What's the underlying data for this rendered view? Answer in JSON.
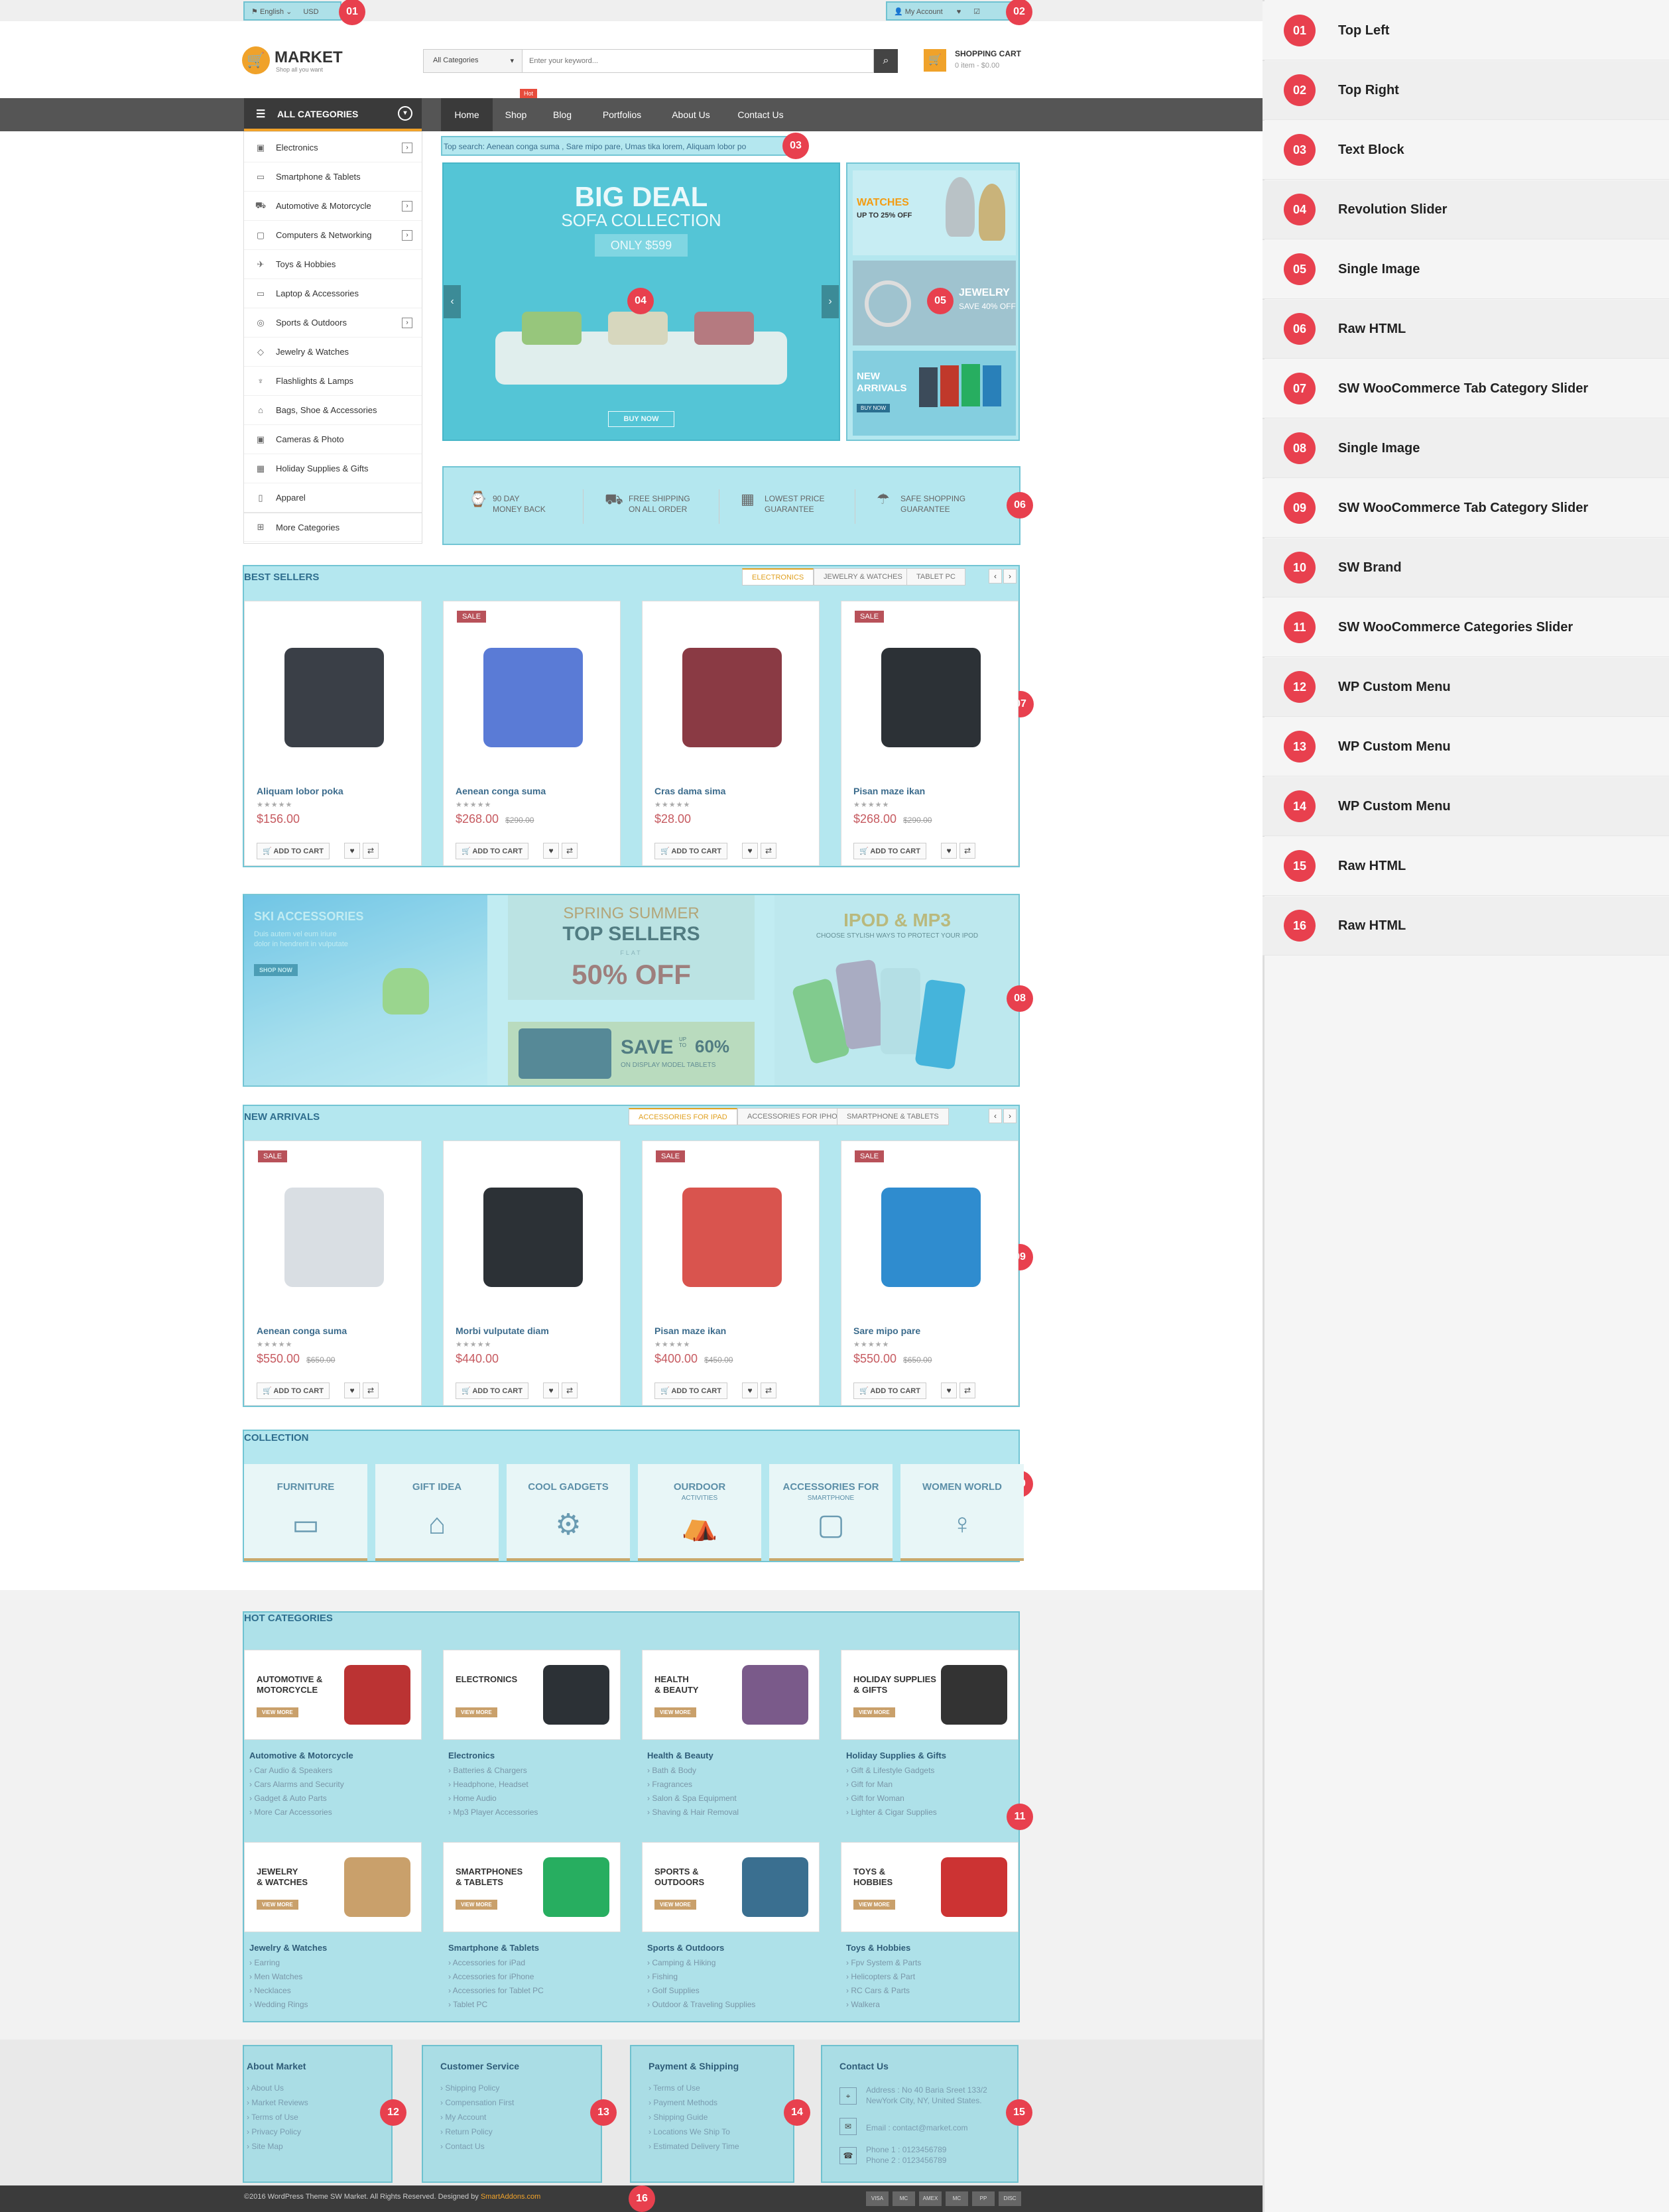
{
  "topbar": {
    "lang": "English",
    "currency": "USD",
    "account": "My Account"
  },
  "header": {
    "logo": "MARKET",
    "tagline": "Shop all you want",
    "cat_select": "All Categories",
    "search_placeholder": "Enter your keyword...",
    "cart_title": "SHOPPING CART",
    "cart_info": "0 item - $0.00"
  },
  "nav": {
    "all_categories": "ALL CATEGORIES",
    "items": [
      "Home",
      "Shop",
      "Blog",
      "Portfolios",
      "About Us",
      "Contact Us"
    ],
    "hot": "Hot"
  },
  "sidebar": {
    "items": [
      "Electronics",
      "Smartphone & Tablets",
      "Automotive & Motorcycle",
      "Computers & Networking",
      "Toys & Hobbies",
      "Laptop & Accessories",
      "Sports & Outdoors",
      "Jewelry & Watches",
      "Flashlights & Lamps",
      "Bags, Shoe & Accessories",
      "Cameras & Photo",
      "Holiday Supplies & Gifts",
      "Apparel",
      "More Categories"
    ]
  },
  "top_search": "Top search: Aenean conga suma , Sare mipo pare, Umas tika lorem, Aliquam lobor po",
  "slider": {
    "title": "BIG DEAL",
    "subtitle": "SOFA COLLECTION",
    "price": "ONLY $599",
    "button": "BUY NOW"
  },
  "side_banners": [
    {
      "title": "WATCHES",
      "line": "UP TO 25% OFF"
    },
    {
      "title": "JEWELRY",
      "line": "SAVE 40% OFF"
    },
    {
      "title": "NEW ARRIVALS",
      "line": "BUY NOW"
    }
  ],
  "features": [
    {
      "l1": "90 DAY",
      "l2": "MONEY BACK"
    },
    {
      "l1": "FREE SHIPPING",
      "l2": "ON ALL ORDER"
    },
    {
      "l1": "LOWEST PRICE",
      "l2": "GUARANTEE"
    },
    {
      "l1": "SAFE SHOPPING",
      "l2": "GUARANTEE"
    }
  ],
  "bestsellers": {
    "title": "BEST SELLERS",
    "tabs": [
      "ELECTRONICS",
      "JEWELRY & WATCHES",
      "TABLET PC"
    ],
    "products": [
      {
        "name": "Aliquam lobor poka",
        "price": "$156.00",
        "old": "",
        "sale": ""
      },
      {
        "name": "Aenean conga suma",
        "price": "$268.00",
        "old": "$290.00",
        "sale": "SALE"
      },
      {
        "name": "Cras dama sima",
        "price": "$28.00",
        "old": "",
        "sale": ""
      },
      {
        "name": "Pisan maze ikan",
        "price": "$268.00",
        "old": "$290.00",
        "sale": "SALE"
      }
    ]
  },
  "add_to_cart": "ADD TO CART",
  "promo": {
    "ski_title": "SKI ACCESSORIES",
    "ski_text": "Duis autem vel eum iriure dolor in hendrerit in vulputate",
    "ski_btn": "SHOP NOW",
    "spring1": "SPRING SUMMER",
    "spring2": "TOP SELLERS",
    "flat": "FLAT",
    "off": "50% OFF",
    "save": "SAVE",
    "upto": "UP TO",
    "save_pct": "60%",
    "save_sub": "ON DISPLAY MODEL TABLETS",
    "ipod": "IPOD & MP3",
    "ipod_sub": "CHOOSE STYLISH WAYS TO PROTECT YOUR IPOD"
  },
  "newarrivals": {
    "title": "NEW ARRIVALS",
    "tabs": [
      "ACCESSORIES FOR IPAD",
      "ACCESSORIES FOR IPHONE",
      "SMARTPHONE & TABLETS"
    ],
    "products": [
      {
        "name": "Aenean conga suma",
        "price": "$550.00",
        "old": "$650.00",
        "sale": "SALE"
      },
      {
        "name": "Morbi vulputate diam",
        "price": "$440.00",
        "old": "",
        "sale": ""
      },
      {
        "name": "Pisan maze ikan",
        "price": "$400.00",
        "old": "$450.00",
        "sale": "SALE"
      },
      {
        "name": "Sare mipo pare",
        "price": "$550.00",
        "old": "$650.00",
        "sale": "SALE"
      }
    ]
  },
  "collection": {
    "title": "COLLECTION",
    "items": [
      {
        "t": "FURNITURE",
        "s": ""
      },
      {
        "t": "GIFT IDEA",
        "s": ""
      },
      {
        "t": "COOL GADGETS",
        "s": ""
      },
      {
        "t": "OURDOOR",
        "s": "ACTIVITIES"
      },
      {
        "t": "ACCESSORIES FOR",
        "s": "SMARTPHONE"
      },
      {
        "t": "WOMEN WORLD",
        "s": ""
      }
    ]
  },
  "hotcats": {
    "title": "HOT CATEGORIES",
    "view_more": "VIEW MORE",
    "cats": [
      {
        "banner": [
          "AUTOMOTIVE &",
          "MOTORCYCLE"
        ],
        "name": "Automotive & Motorcycle",
        "links": [
          "Car Audio & Speakers",
          "Cars Alarms and Security",
          "Gadget & Auto Parts",
          "More Car Accessories"
        ]
      },
      {
        "banner": [
          "ELECTRONICS",
          ""
        ],
        "name": "Electronics",
        "links": [
          "Batteries & Chargers",
          "Headphone, Headset",
          "Home Audio",
          "Mp3 Player Accessories"
        ]
      },
      {
        "banner": [
          "HEALTH",
          "& BEAUTY"
        ],
        "name": "Health & Beauty",
        "links": [
          "Bath & Body",
          "Fragrances",
          "Salon & Spa Equipment",
          "Shaving & Hair Removal"
        ]
      },
      {
        "banner": [
          "HOLIDAY SUPPLIES",
          "& GIFTS"
        ],
        "name": "Holiday Supplies & Gifts",
        "links": [
          "Gift & Lifestyle Gadgets",
          "Gift for Man",
          "Gift for Woman",
          "Lighter & Cigar Supplies"
        ]
      },
      {
        "banner": [
          "JEWELRY",
          "& WATCHES"
        ],
        "name": "Jewelry & Watches",
        "links": [
          "Earring",
          "Men Watches",
          "Necklaces",
          "Wedding Rings"
        ]
      },
      {
        "banner": [
          "SMARTPHONES",
          "& TABLETS"
        ],
        "name": "Smartphone & Tablets",
        "links": [
          "Accessories for iPad",
          "Accessories for iPhone",
          "Accessories for Tablet PC",
          "Tablet PC"
        ]
      },
      {
        "banner": [
          "SPORTS &",
          "OUTDOORS"
        ],
        "name": "Sports & Outdoors",
        "links": [
          "Camping & Hiking",
          "Fishing",
          "Golf Supplies",
          "Outdoor & Traveling Supplies"
        ]
      },
      {
        "banner": [
          "TOYS &",
          "HOBBIES"
        ],
        "name": "Toys & Hobbies",
        "links": [
          "Fpv System & Parts",
          "Helicopters & Part",
          "RC Cars & Parts",
          "Walkera"
        ]
      }
    ]
  },
  "footer": {
    "cols": [
      {
        "title": "About Market",
        "links": [
          "About Us",
          "Market Reviews",
          "Terms of Use",
          "Privacy Policy",
          "Site Map"
        ]
      },
      {
        "title": "Customer Service",
        "links": [
          "Shipping Policy",
          "Compensation First",
          "My Account",
          "Return Policy",
          "Contact Us"
        ]
      },
      {
        "title": "Payment & Shipping",
        "links": [
          "Terms of Use",
          "Payment Methods",
          "Shipping Guide",
          "Locations We Ship To",
          "Estimated Delivery Time"
        ]
      }
    ],
    "contact_title": "Contact Us",
    "address": [
      "Address : No 40 Baria Sreet 133/2",
      "NewYork City, NY, United States."
    ],
    "email": "Email : contact@market.com",
    "phone": [
      "Phone 1 : 0123456789",
      "Phone 2 : 0123456789"
    ],
    "copyright": "©2016 WordPress Theme SW Market. All Rights Reserved. Designed by",
    "designer": "SmartAddons.com",
    "payments": [
      "VISA",
      "MC",
      "AMEX",
      "MC",
      "PP",
      "DISC"
    ]
  },
  "badges": [
    "01",
    "02",
    "03",
    "04",
    "05",
    "06",
    "07",
    "08",
    "09",
    "10",
    "11",
    "12",
    "13",
    "14",
    "15",
    "16"
  ],
  "legend": [
    "Top Left",
    "Top Right",
    "Text Block",
    "Revolution Slider",
    "Single Image",
    "Raw HTML",
    "SW WooCommerce Tab Category Slider",
    "Single Image",
    "SW WooCommerce Tab Category Slider",
    "SW Brand",
    "SW WooCommerce Categories Slider",
    "WP Custom Menu",
    "WP Custom Menu",
    "WP Custom Menu",
    "Raw HTML",
    "Raw HTML"
  ]
}
